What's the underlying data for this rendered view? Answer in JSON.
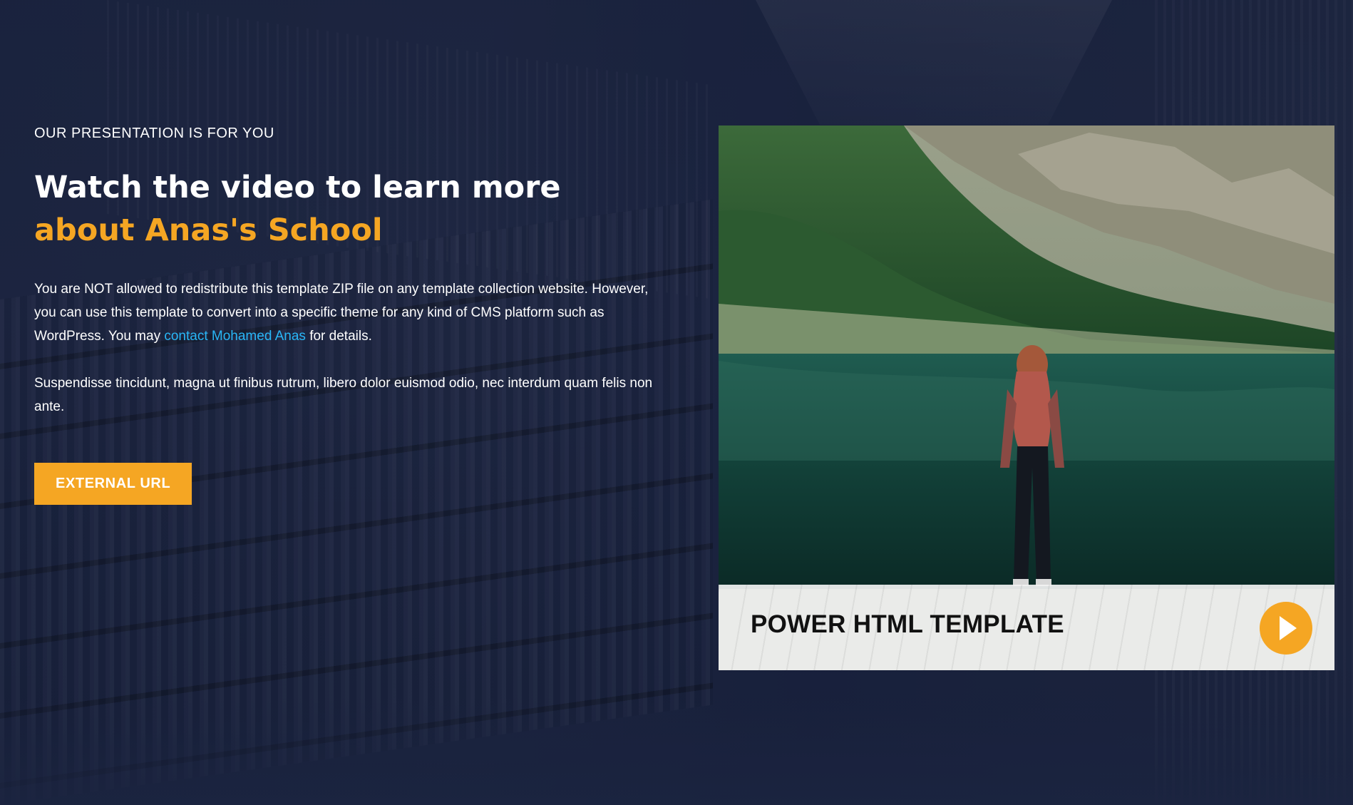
{
  "intro": {
    "eyebrow": "OUR PRESENTATION IS FOR YOU",
    "headline_line1": "Watch the video to learn more",
    "headline_line2": "about Anas's School",
    "paragraph1_before_link": "You are NOT allowed to redistribute this template ZIP file on any template collection website. However, you can use this template to convert into a specific theme for any kind of CMS platform such as WordPress. You may ",
    "paragraph1_link": "contact Mohamed Anas",
    "paragraph1_after_link": " for details.",
    "paragraph2": "Suspendisse tincidunt, magna ut finibus rutrum, libero dolor euismod odio, nec interdum quam felis non ante.",
    "button_label": "EXTERNAL URL"
  },
  "video": {
    "caption": "POWER HTML TEMPLATE",
    "play_icon": "play-icon"
  },
  "colors": {
    "accent": "#f5a623",
    "link": "#29b6f6",
    "background": "#1b2440"
  }
}
